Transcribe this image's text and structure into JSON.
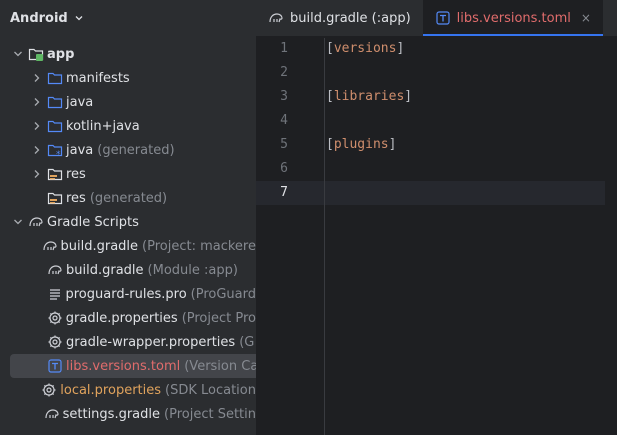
{
  "project": {
    "view_label": "Android",
    "tree": [
      {
        "label": "app",
        "indent": 0,
        "arrow": "down",
        "icon": "module-folder",
        "bold": true
      },
      {
        "label": "manifests",
        "indent": 1,
        "arrow": "right",
        "icon": "folder"
      },
      {
        "label": "java",
        "indent": 1,
        "arrow": "right",
        "icon": "folder"
      },
      {
        "label": "kotlin+java",
        "indent": 1,
        "arrow": "right",
        "icon": "folder"
      },
      {
        "label": "java",
        "sub": "(generated)",
        "indent": 1,
        "arrow": "right",
        "icon": "generated-folder"
      },
      {
        "label": "res",
        "indent": 1,
        "arrow": "right",
        "icon": "res-folder"
      },
      {
        "label": "res",
        "sub": "(generated)",
        "indent": 1,
        "arrow": "none",
        "icon": "res-folder"
      },
      {
        "label": "Gradle Scripts",
        "indent": 0,
        "arrow": "down",
        "icon": "gradle-elephant"
      },
      {
        "label": "build.gradle",
        "sub": "(Project: mackere",
        "indent": 1,
        "arrow": "none",
        "icon": "gradle-elephant"
      },
      {
        "label": "build.gradle",
        "sub": "(Module :app)",
        "indent": 1,
        "arrow": "none",
        "icon": "gradle-elephant"
      },
      {
        "label": "proguard-rules.pro",
        "sub": "(ProGuard",
        "indent": 1,
        "arrow": "none",
        "icon": "text-lines"
      },
      {
        "label": "gradle.properties",
        "sub": "(Project Pro",
        "indent": 1,
        "arrow": "none",
        "icon": "gear"
      },
      {
        "label": "gradle-wrapper.properties",
        "sub": "(G",
        "indent": 1,
        "arrow": "none",
        "icon": "gear"
      },
      {
        "label": "libs.versions.toml",
        "sub": "(Version Ca",
        "indent": 1,
        "arrow": "none",
        "icon": "toml",
        "color": "red",
        "selected": true
      },
      {
        "label": "local.properties",
        "sub": "(SDK Location",
        "indent": 1,
        "arrow": "none",
        "icon": "gear",
        "color": "orange"
      },
      {
        "label": "settings.gradle",
        "sub": "(Project Settin",
        "indent": 1,
        "arrow": "none",
        "icon": "gradle-elephant"
      }
    ]
  },
  "editor": {
    "tabs": [
      {
        "label": "build.gradle (:app)",
        "icon": "gradle-elephant",
        "active": false
      },
      {
        "label": "libs.versions.toml",
        "icon": "toml",
        "active": true,
        "close": "×"
      }
    ],
    "line_numbers": [
      "1",
      "2",
      "3",
      "4",
      "5",
      "6",
      "7"
    ],
    "current_line": "7",
    "lines": [
      {
        "n": "1",
        "text": "versions"
      },
      {
        "n": "3",
        "text": "libraries"
      },
      {
        "n": "5",
        "text": "plugins"
      }
    ],
    "bracket_open": "[",
    "bracket_close": "]"
  },
  "colors": {
    "accent": "#3574f0",
    "selected_row": "#43454a",
    "keyword": "#cf8e6d",
    "red_file": "#e06c6c",
    "orange_file": "#e0a35d"
  }
}
